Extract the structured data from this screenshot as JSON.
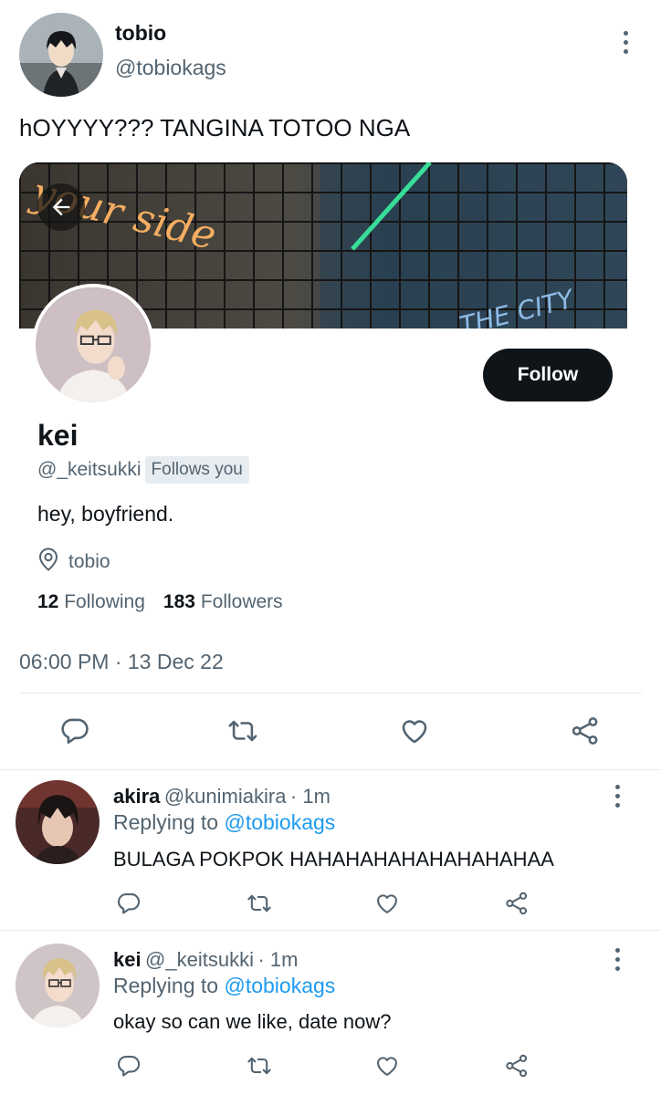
{
  "tweet": {
    "author_name": "tobio",
    "author_handle": "@tobiokags",
    "text": "hOYYYY??? TANGINA TOTOO NGA",
    "timestamp": "06:00 PM · 13 Dec 22"
  },
  "profile_card": {
    "banner_text_1": "your side",
    "banner_text_2": "THE CITY",
    "name": "kei",
    "handle": "@_keitsukki",
    "follows_you": "Follows you",
    "bio": "hey, boyfriend.",
    "location": "tobio",
    "following_count": "12",
    "following_label": "Following",
    "followers_count": "183",
    "followers_label": "Followers",
    "follow_button": "Follow"
  },
  "replies": [
    {
      "name": "akira",
      "handle": "@kunimiakira",
      "time": "· 1m",
      "replying_prefix": "Replying to",
      "replying_to": "@tobiokags",
      "text": "BULAGA POKPOK HAHAHAHAHAHAHAHAHAA"
    },
    {
      "name": "kei",
      "handle": "@_keitsukki",
      "time": "· 1m",
      "replying_prefix": "Replying to",
      "replying_to": "@tobiokags",
      "text": "okay so can we like, date now?"
    }
  ],
  "icons": [
    "more-icon",
    "back-arrow-icon",
    "location-icon",
    "reply-icon",
    "retweet-icon",
    "like-icon",
    "share-icon"
  ],
  "colors": {
    "link": "#1d9bf0",
    "secondary_text": "#536471",
    "primary_text": "#0f1419",
    "follow_bg": "#0f1419"
  }
}
